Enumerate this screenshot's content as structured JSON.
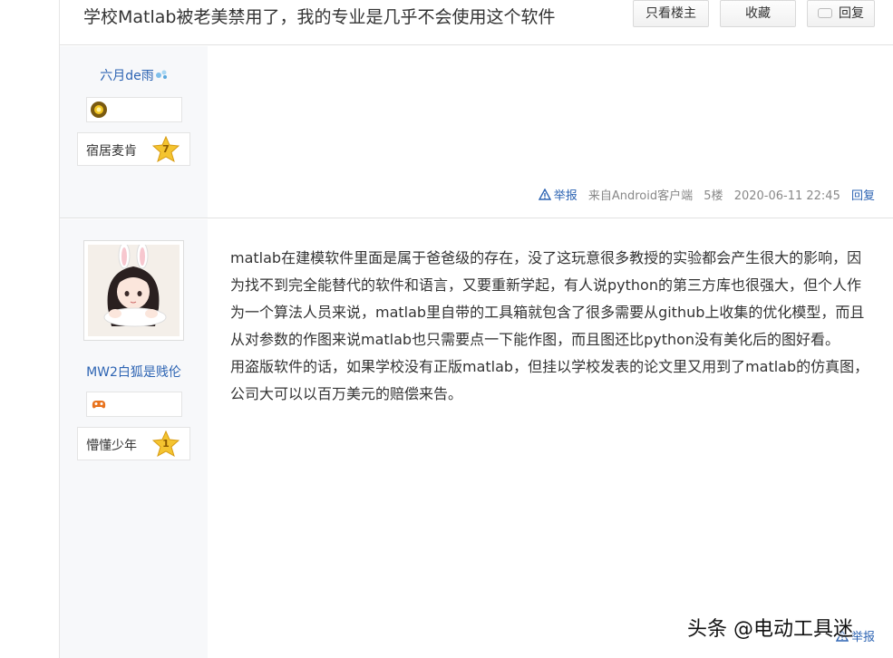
{
  "header": {
    "title": "学校Matlab被老美禁用了，我的专业是几乎不会使用这个软件",
    "btn_only_op": "只看楼主",
    "btn_favorite": "收藏",
    "btn_reply": "回复"
  },
  "posts": [
    {
      "author": {
        "username": "六月de雨",
        "level_title": "宿居麦肯",
        "level_number": "7",
        "badge_icon": "sun-badge-icon"
      },
      "meta": {
        "report_label": "举报",
        "source": "来自Android客户端",
        "floor": "5楼",
        "timestamp": "2020-06-11 22:45",
        "reply_label": "回复"
      }
    },
    {
      "author": {
        "username": "MW2白狐是贱伦",
        "level_title": "懵懂少年",
        "level_number": "1",
        "badge_icon": "gamepad-badge-icon"
      },
      "content": [
        "matlab在建模软件里面是属于爸爸级的存在，没了这玩意很多教授的实验都会产生很大的影响，因为找不到完全能替代的软件和语言，又要重新学起，有人说python的第三方库也很强大，但个人作为一个算法人员来说，matlab里自带的工具箱就包含了很多需要从github上收集的优化模型，而且从对参数的作图来说matlab也只需要点一下能作图，而且图还比python没有美化后的图好看。",
        "用盗版软件的话，如果学校没有正版matlab，但挂以学校发表的论文里又用到了matlab的仿真图，公司大可以以百万美元的赔偿来告。"
      ],
      "meta": {
        "report_label": "举报"
      }
    }
  ],
  "watermark": "头条 @电动工具迷",
  "colors": {
    "link": "#2d64b3",
    "author_bg": "#f7f8fa",
    "border": "#e1e1e1"
  }
}
